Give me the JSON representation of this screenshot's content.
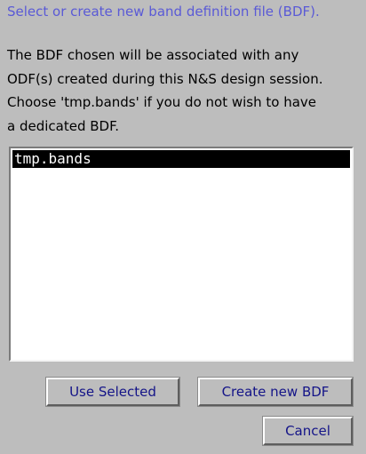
{
  "dialog": {
    "title": "Select or create new band definition file (BDF).",
    "description": [
      "The BDF chosen will be associated with any",
      "ODF(s) created during this N&S design session.",
      "Choose 'tmp.bands' if you do not wish to have",
      "a dedicated BDF."
    ]
  },
  "list": {
    "items": [
      {
        "label": "tmp.bands",
        "selected": true
      }
    ]
  },
  "buttons": {
    "use_selected": "Use Selected",
    "create_new": "Create new BDF",
    "cancel": "Cancel"
  },
  "colors": {
    "title": "#5a5ad6",
    "button_text": "#141488",
    "background": "#bdbdbd"
  }
}
